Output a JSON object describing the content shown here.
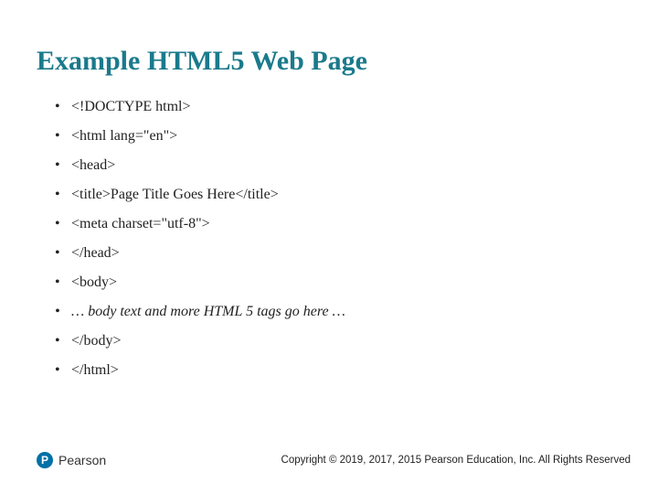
{
  "title": "Example HTML5 Web Page",
  "lines": [
    "<!DOCTYPE html>",
    "<html lang=\"en\">",
    "<head>",
    "<title>Page Title Goes Here</title>",
    "<meta charset=\"utf-8\">",
    "</head>",
    "<body>",
    "… body text and more HTML 5 tags go here …",
    "</body>",
    "</html>"
  ],
  "italic_index": 7,
  "logo": {
    "initial": "P",
    "name": "Pearson"
  },
  "copyright": "Copyright © 2019, 2017, 2015 Pearson Education, Inc. All Rights Reserved"
}
